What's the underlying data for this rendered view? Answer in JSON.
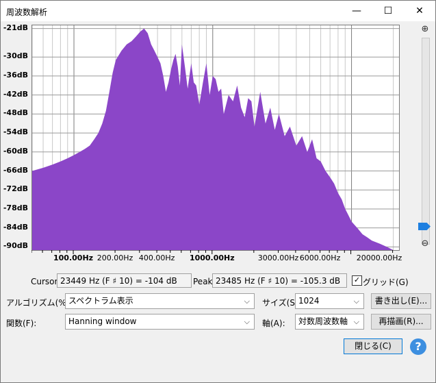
{
  "window": {
    "title": "周波数解析",
    "minimize_glyph": "—",
    "maximize_glyph": "☐",
    "close_glyph": "✕"
  },
  "chart_data": {
    "type": "area",
    "title": "",
    "xlabel": "",
    "ylabel": "",
    "x_scale": "log",
    "xlim": [
      50,
      22000
    ],
    "ylim": [
      -91,
      -20
    ],
    "yticks": [
      "-21dB",
      "-30dB",
      "-36dB",
      "-42dB",
      "-48dB",
      "-54dB",
      "-60dB",
      "-66dB",
      "-72dB",
      "-78dB",
      "-84dB",
      "-90dB"
    ],
    "ytick_values": [
      -21,
      -30,
      -36,
      -42,
      -48,
      -54,
      -60,
      -66,
      -72,
      -78,
      -84,
      -90
    ],
    "xticks": [
      {
        "label": "100.00Hz",
        "value": 100,
        "major": true
      },
      {
        "label": "200.00Hz",
        "value": 200,
        "major": false
      },
      {
        "label": "400.00Hz",
        "value": 400,
        "major": false
      },
      {
        "label": "1000.00Hz",
        "value": 1000,
        "major": true
      },
      {
        "label": "3000.00Hz",
        "value": 3000,
        "major": false
      },
      {
        "label": "6000.00Hz",
        "value": 6000,
        "major": false
      },
      {
        "label": "20000.00Hz",
        "value": 20000,
        "major": false
      }
    ],
    "grid": true,
    "color": "#8b46c8",
    "series": [
      {
        "x": [
          50,
          60,
          70,
          80,
          90,
          100,
          110,
          120,
          130,
          140,
          150,
          160,
          170,
          180,
          190,
          200,
          220,
          240,
          260,
          280,
          300,
          320,
          340,
          360,
          380,
          400,
          420,
          440,
          460,
          480,
          500,
          520,
          540,
          560,
          580,
          600,
          630,
          660,
          700,
          730,
          760,
          800,
          850,
          900,
          950,
          1000,
          1050,
          1100,
          1150,
          1200,
          1300,
          1400,
          1500,
          1600,
          1700,
          1800,
          1900,
          2000,
          2200,
          2400,
          2600,
          2800,
          3000,
          3300,
          3600,
          4000,
          4400,
          4800,
          5200,
          5600,
          6000,
          6500,
          7000,
          7500,
          8000,
          8500,
          9000,
          9500,
          10000,
          11000,
          12000,
          13000,
          14000,
          16000,
          18000,
          20000,
          22000
        ],
        "y": [
          -66,
          -65,
          -64,
          -63,
          -62,
          -61,
          -60,
          -59,
          -58,
          -56,
          -54,
          -51,
          -47,
          -41,
          -35,
          -31,
          -28,
          -26,
          -25,
          -23.5,
          -22,
          -21,
          -22.5,
          -26,
          -28,
          -30,
          -32,
          -36,
          -41,
          -38,
          -34,
          -31,
          -29,
          -33,
          -39,
          -26,
          -33,
          -40,
          -32,
          -38,
          -39,
          -45,
          -38,
          -32,
          -42,
          -36,
          -37,
          -41,
          -40,
          -48,
          -42,
          -44,
          -39,
          -46,
          -49,
          -43,
          -44,
          -52,
          -41,
          -51,
          -46,
          -53,
          -48,
          -55,
          -52,
          -58,
          -55,
          -60,
          -56,
          -62,
          -63,
          -66,
          -68,
          -70,
          -73,
          -75,
          -78,
          -80,
          -82,
          -84,
          -86,
          -87,
          -88,
          -89,
          -90,
          -91,
          -91
        ]
      }
    ]
  },
  "cursor": {
    "label": "Cursor:",
    "value": "23449 Hz (F ♯ 10) = -104 dB"
  },
  "peak": {
    "label": "Peak:",
    "value": "23485 Hz (F ♯ 10) = -105.3 dB"
  },
  "grid": {
    "label": "グリッド(G)",
    "checked": "✓"
  },
  "algorithm": {
    "label": "アルゴリズム(%A):",
    "value": "スペクトラム表示"
  },
  "function": {
    "label": "関数(F):",
    "value": "Hanning window"
  },
  "size": {
    "label": "サイズ(S):",
    "value": "1024"
  },
  "axis": {
    "label": "軸(A):",
    "value": "対数周波数軸"
  },
  "buttons": {
    "export": "書き出し(E)...",
    "replot": "再描画(R)...",
    "close": "閉じる(C)",
    "help": "?"
  },
  "zoom": {
    "in_glyph": "⊕",
    "out_glyph": "⊖"
  },
  "icons": {
    "caret": "⌵"
  }
}
